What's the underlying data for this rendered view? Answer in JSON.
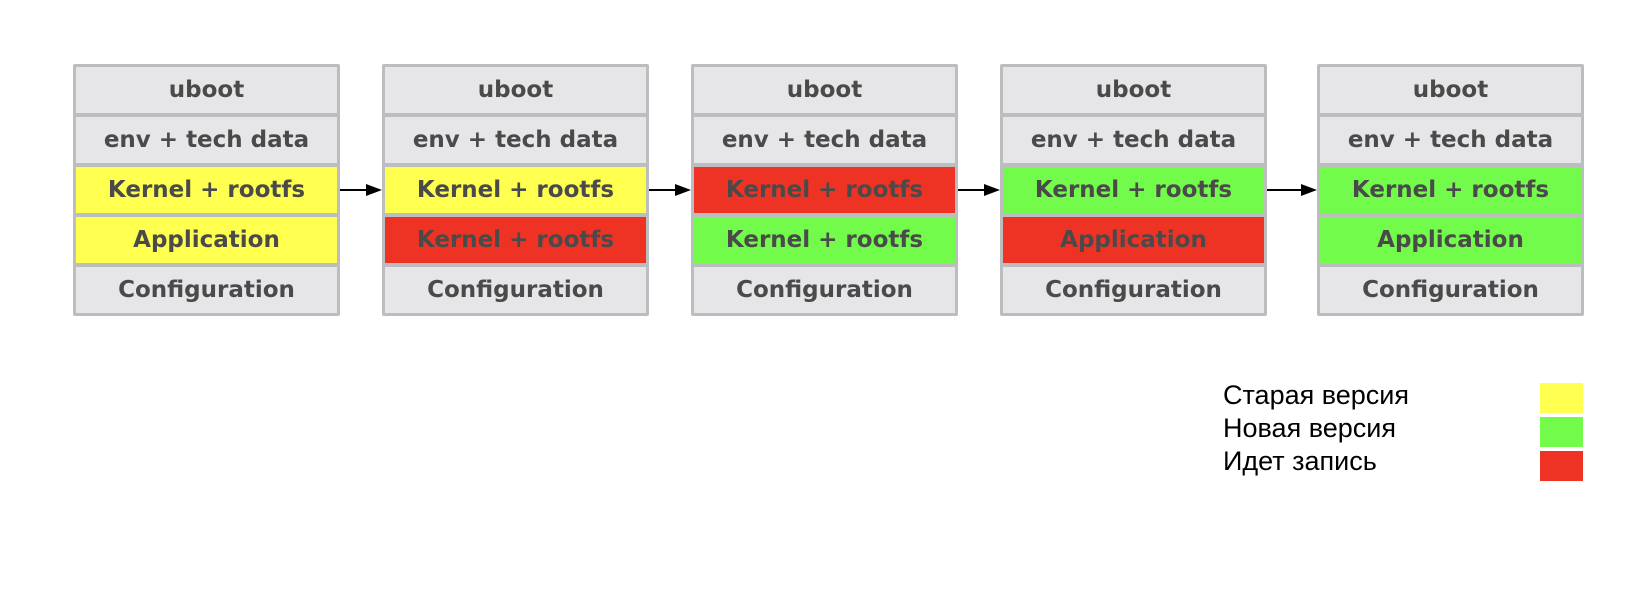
{
  "colors": {
    "old": "#ffff50",
    "new": "#72fb4a",
    "writing": "#ee3325",
    "neutral": "#e6e6e8"
  },
  "blocks": [
    {
      "cells": [
        {
          "label": "uboot",
          "state": "neutral"
        },
        {
          "label": "env + tech data",
          "state": "neutral"
        },
        {
          "label": "Kernel + rootfs",
          "state": "old"
        },
        {
          "label": "Application",
          "state": "old"
        },
        {
          "label": "Configuration",
          "state": "neutral"
        }
      ]
    },
    {
      "cells": [
        {
          "label": "uboot",
          "state": "neutral"
        },
        {
          "label": "env + tech data",
          "state": "neutral"
        },
        {
          "label": "Kernel + rootfs",
          "state": "old"
        },
        {
          "label": "Kernel + rootfs",
          "state": "writing"
        },
        {
          "label": "Configuration",
          "state": "neutral"
        }
      ]
    },
    {
      "cells": [
        {
          "label": "uboot",
          "state": "neutral"
        },
        {
          "label": "env + tech data",
          "state": "neutral"
        },
        {
          "label": "Kernel + rootfs",
          "state": "writing"
        },
        {
          "label": "Kernel + rootfs",
          "state": "new"
        },
        {
          "label": "Configuration",
          "state": "neutral"
        }
      ]
    },
    {
      "cells": [
        {
          "label": "uboot",
          "state": "neutral"
        },
        {
          "label": "env + tech data",
          "state": "neutral"
        },
        {
          "label": "Kernel + rootfs",
          "state": "new"
        },
        {
          "label": "Application",
          "state": "writing"
        },
        {
          "label": "Configuration",
          "state": "neutral"
        }
      ]
    },
    {
      "cells": [
        {
          "label": "uboot",
          "state": "neutral"
        },
        {
          "label": "env + tech data",
          "state": "neutral"
        },
        {
          "label": "Kernel + rootfs",
          "state": "new"
        },
        {
          "label": "Application",
          "state": "new"
        },
        {
          "label": "Configuration",
          "state": "neutral"
        }
      ]
    }
  ],
  "legend": [
    {
      "label": "Старая версия",
      "state": "old"
    },
    {
      "label": "Новая версия",
      "state": "new"
    },
    {
      "label": "Идет запись",
      "state": "writing"
    }
  ]
}
